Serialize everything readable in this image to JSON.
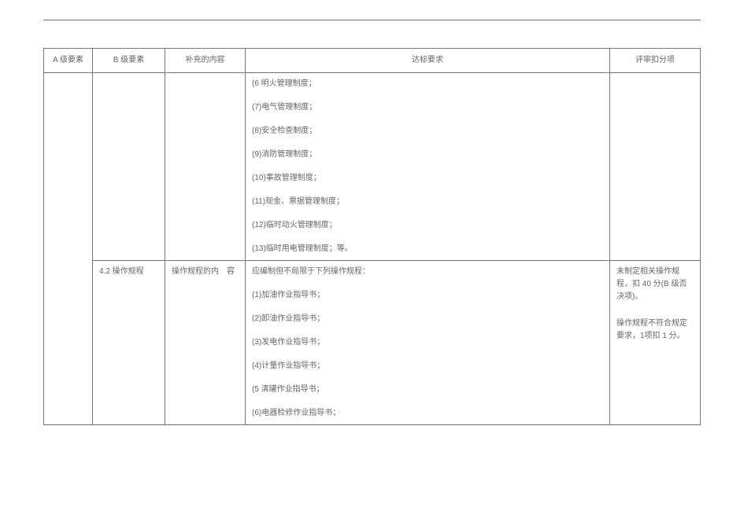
{
  "headers": {
    "a": "A 级要素",
    "b": "B 级要素",
    "supplement": "补充的内容",
    "requirement": "达标要求",
    "scoring": "评审扣分项"
  },
  "row1": {
    "requirements": [
      "(6 明火管理制度；",
      "(7)电气管理制度；",
      "(8)安全检查制度；",
      "(9)消防管理制度；",
      "(10)事故管理制度；",
      "(11)现金、票据管理制度；",
      "(12)临时动火管理制度；",
      "(13)临时用电管理制度；等。"
    ]
  },
  "row2": {
    "b_level": "4.2 操作规程",
    "supplement": "操作规程的内　容",
    "req_intro": "应编制但不局限于下列操作规程：",
    "requirements": [
      "(1)加油作业指导书；",
      "(2)卸油作业指导书；",
      "(3)发电作业指导书；",
      "(4)计量作业指导书；",
      "(5 清罐作业指导书；",
      "(6)电器检修作业指导书；"
    ],
    "scoring_1": "未制定相关操作规程，扣 40 分(B 级否　决项)。",
    "scoring_2": "操作规程不符合规定要求，1项扣 1 分。"
  }
}
